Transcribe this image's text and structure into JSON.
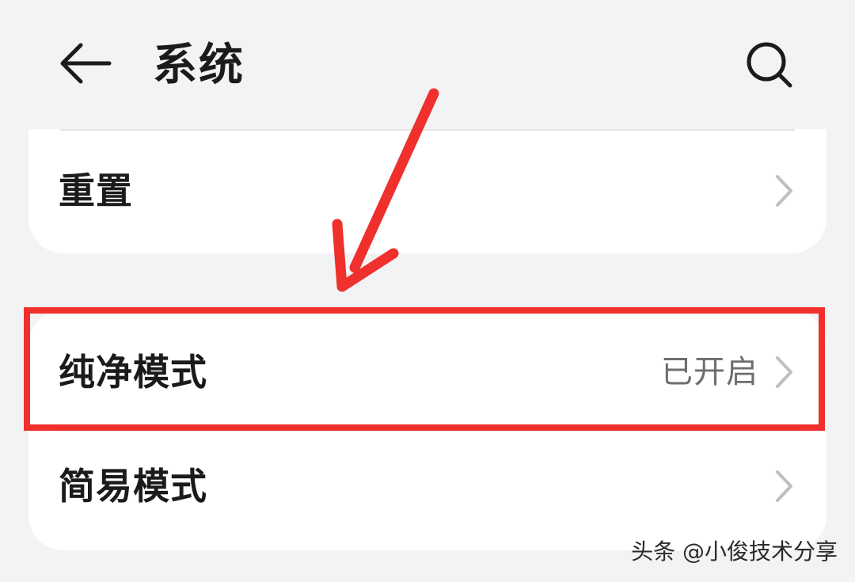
{
  "header": {
    "title": "系统",
    "back_icon": "arrow-left-icon",
    "search_icon": "search-icon"
  },
  "settings": {
    "reset": {
      "label": "重置"
    },
    "pure_mode": {
      "label": "纯净模式",
      "value": "已开启"
    },
    "simple_mode": {
      "label": "简易模式"
    }
  },
  "annotation": {
    "highlight_color": "#f0302c",
    "arrow_color": "#f0302c",
    "highlight_target": "pure_mode"
  },
  "watermark": {
    "text": "头条 @小俊技术分享"
  },
  "colors": {
    "background": "#f1f3f5",
    "card": "#ffffff",
    "primary_text": "#1b1b1b",
    "secondary_text": "#6e6e6e",
    "chevron": "#bfbfbf"
  }
}
